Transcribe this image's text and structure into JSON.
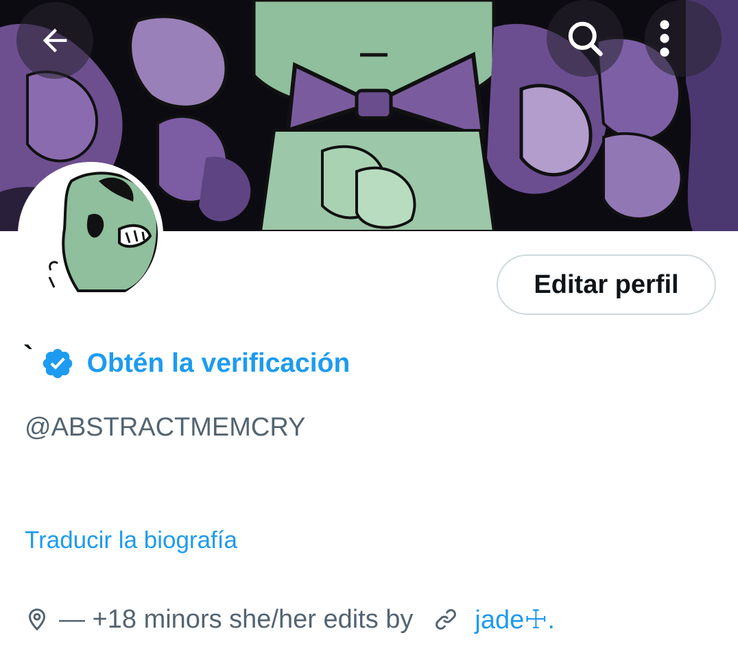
{
  "colors": {
    "accent": "#1d9bf0",
    "text_primary": "#0f1419",
    "text_secondary": "#536471",
    "border": "#cfd9de",
    "banner_green": "#8fbf9c",
    "banner_purple": "#7a5c9e"
  },
  "header": {
    "back_icon": "arrow-left-icon",
    "search_icon": "search-icon",
    "more_icon": "more-vertical-icon"
  },
  "profile": {
    "display_name": "`",
    "verification_link": "Obtén la verificación",
    "handle": "@ABSTRACTMEMCRY",
    "edit_button": "Editar perfil",
    "translate_bio": "Traducir la biografía",
    "location": "— +18 minors she/her edits by",
    "website": "jade☩."
  }
}
